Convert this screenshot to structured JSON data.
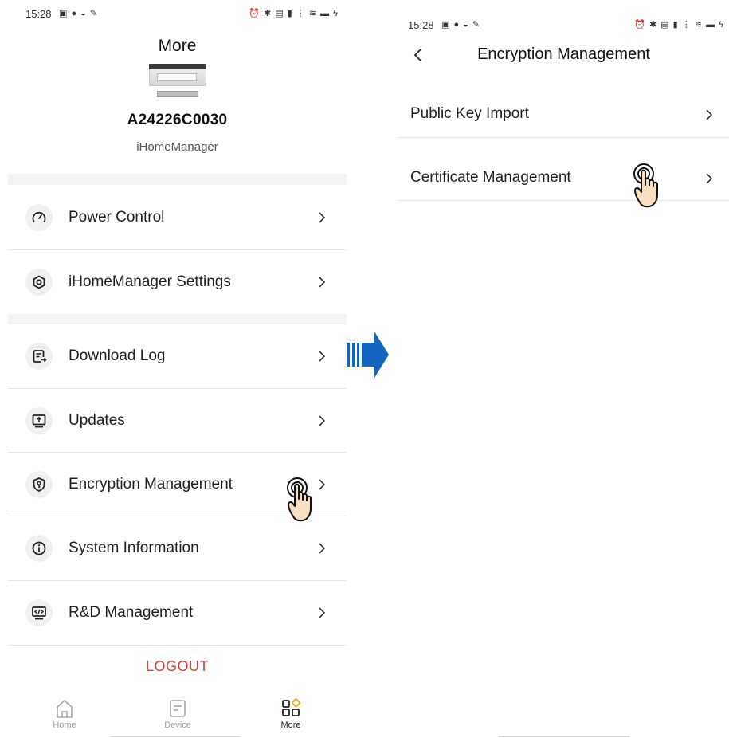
{
  "left": {
    "status": {
      "time": "15:28",
      "left_icons": "▣ ● ◒ ✎",
      "right_icons": "⏰ ✱ ▤ ▮ ⋮ ≋ ▬ ϟ"
    },
    "title": "More",
    "device": {
      "id": "A24226C0030",
      "type": "iHomeManager"
    },
    "menu": [
      {
        "label": "Power Control",
        "icon": "gauge-icon"
      },
      {
        "label": "iHomeManager Settings",
        "icon": "settings-nut-icon"
      },
      {
        "label": "Download Log",
        "icon": "download-log-icon"
      },
      {
        "label": "Updates",
        "icon": "upload-monitor-icon"
      },
      {
        "label": "Encryption Management",
        "icon": "shield-key-icon"
      },
      {
        "label": "System Information",
        "icon": "info-icon"
      },
      {
        "label": "R&D Management",
        "icon": "code-monitor-icon"
      }
    ],
    "logout_label": "LOGOUT",
    "tabs": [
      {
        "label": "Home",
        "icon": "home-icon"
      },
      {
        "label": "Device",
        "icon": "device-icon"
      },
      {
        "label": "More",
        "icon": "more-grid-icon"
      }
    ],
    "active_tab": "More"
  },
  "right": {
    "status": {
      "time": "15:28",
      "left_icons": "▣ ● ◒ ✎",
      "right_icons": "⏰ ✱ ▤ ▮ ⋮ ≋ ▬ ϟ"
    },
    "title": "Encryption Management",
    "items": [
      {
        "label": "Public Key Import"
      },
      {
        "label": "Certificate Management"
      }
    ]
  },
  "colors": {
    "logout": "#e53935",
    "arrow": "#1565c0",
    "accent_more": "#f5a623",
    "divider": "#e6e6e6"
  },
  "icons": {
    "tap_gesture": "tap-hand-icon",
    "flow": "flow-arrow-icon",
    "back": "back-chevron-icon",
    "row_chevron": "chevron-right-icon"
  }
}
